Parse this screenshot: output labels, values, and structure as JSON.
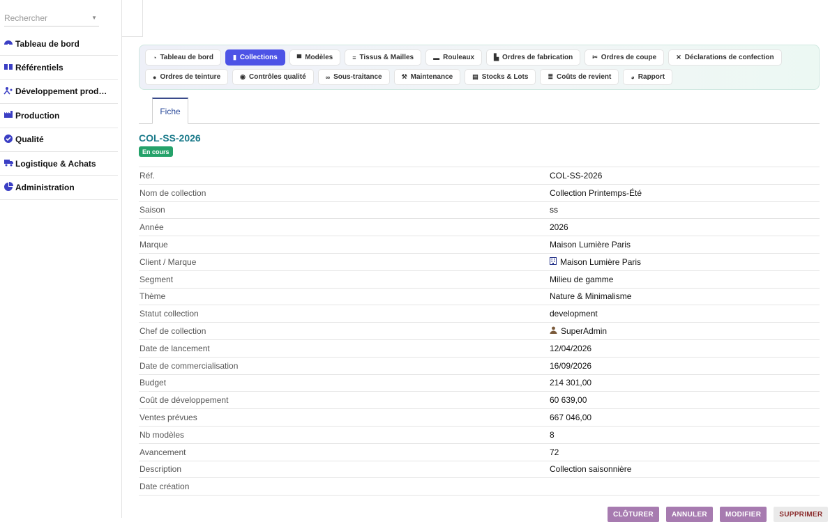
{
  "search": {
    "placeholder": "Rechercher"
  },
  "sidebar": {
    "items": [
      {
        "label": "Tableau de bord",
        "icon": "dashboard-icon"
      },
      {
        "label": "Référentiels",
        "icon": "book-icon"
      },
      {
        "label": "Développement prod…",
        "icon": "people-icon"
      },
      {
        "label": "Production",
        "icon": "factory-icon"
      },
      {
        "label": "Qualité",
        "icon": "check-circle-icon"
      },
      {
        "label": "Logistique & Achats",
        "icon": "truck-icon"
      },
      {
        "label": "Administration",
        "icon": "pie-chart-icon"
      }
    ]
  },
  "tabs": {
    "row1": [
      {
        "label": "Tableau de bord",
        "icon": "dashboard-icon"
      },
      {
        "label": "Collections",
        "icon": "book-icon",
        "active": true
      },
      {
        "label": "Modèles",
        "icon": "shirt-icon"
      },
      {
        "label": "Tissus & Mailles",
        "icon": "layers-icon"
      },
      {
        "label": "Rouleaux",
        "icon": "roll-icon"
      },
      {
        "label": "Ordres de fabrication",
        "icon": "factory-icon"
      },
      {
        "label": "Ordres de coupe",
        "icon": "scissors-icon"
      },
      {
        "label": "Déclarations de confection",
        "icon": "tools-icon"
      }
    ],
    "row2": [
      {
        "label": "Ordres de teinture",
        "icon": "drop-icon"
      },
      {
        "label": "Contrôles qualité",
        "icon": "check-circle-icon"
      },
      {
        "label": "Sous-traitance",
        "icon": "handshake-icon"
      },
      {
        "label": "Maintenance",
        "icon": "wrench-icon"
      },
      {
        "label": "Stocks & Lots",
        "icon": "warehouse-icon"
      },
      {
        "label": "Coûts de revient",
        "icon": "coins-icon"
      },
      {
        "label": "Rapport",
        "icon": "pie-chart-icon"
      }
    ]
  },
  "fiche": {
    "tab_label": "Fiche",
    "title": "COL-SS-2026",
    "status_badge": "En cours",
    "status_color": "#25a26a"
  },
  "properties": [
    {
      "label": "Réf.",
      "value": "COL-SS-2026"
    },
    {
      "label": "Nom de collection",
      "value": "Collection Printemps-Été"
    },
    {
      "label": "Saison",
      "value": "ss"
    },
    {
      "label": "Année",
      "value": "2026"
    },
    {
      "label": "Marque",
      "value": "Maison Lumière Paris"
    },
    {
      "label": "Client / Marque",
      "value": "Maison Lumière Paris",
      "kind": "link",
      "icon": "building-icon"
    },
    {
      "label": "Segment",
      "value": "Milieu de gamme"
    },
    {
      "label": "Thème",
      "value": "Nature & Minimalisme"
    },
    {
      "label": "Statut collection",
      "value": "development"
    },
    {
      "label": "Chef de collection",
      "value": "SuperAdmin",
      "kind": "link",
      "icon": "user-icon"
    },
    {
      "label": "Date de lancement",
      "value": "12/04/2026"
    },
    {
      "label": "Date de commercialisation",
      "value": "16/09/2026"
    },
    {
      "label": "Budget",
      "value": "214 301,00",
      "kind": "num"
    },
    {
      "label": "Coût de développement",
      "value": "60 639,00",
      "kind": "num"
    },
    {
      "label": "Ventes prévues",
      "value": "667 046,00",
      "kind": "num"
    },
    {
      "label": "Nb modèles",
      "value": "8"
    },
    {
      "label": "Avancement",
      "value": "72"
    },
    {
      "label": "Description",
      "value": "Collection saisonnière"
    },
    {
      "label": "Date création",
      "value": ""
    }
  ],
  "actions": {
    "close": "CLÔTURER",
    "cancel": "ANNULER",
    "edit": "MODIFIER",
    "delete": "SUPPRIMER"
  }
}
